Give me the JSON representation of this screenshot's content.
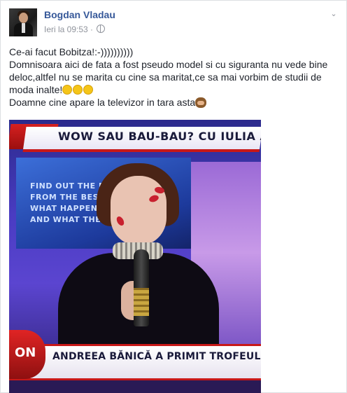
{
  "post": {
    "author": "Bogdan Vladau",
    "timestamp": "Ieri la 09:53",
    "separator": " · ",
    "privacy_icon": "globe-icon",
    "menu_icon": "chevron-down-icon",
    "lines": [
      "Ce-ai facut Bobitza!:-))))))))))",
      "Domnisoara aici de fata a fost pseudo model si cu siguranta nu vede bine deloc,altfel nu se marita cu cine sa maritat,ce sa mai vorbim de studii de moda inalte!",
      "Doamne cine apare la televizor in tara asta"
    ],
    "emoji_after_line_2": [
      "grinning-squint-face",
      "grimacing-face",
      "grinning-squint-face"
    ],
    "emoji_after_line_3": "see-no-evil-monkey"
  },
  "photo": {
    "banner_text": "WOW SAU BAU-BAU? CU IULIA ALB",
    "screen_lines": [
      "FIND OUT THE BE       COVE",
      "FROM THE BEST         E SCE",
      "WHAT HAPPENS         R",
      "AND WHAT THE"
    ],
    "lower_logo": "ON",
    "lower_third_text": "ANDREEA BĂNICĂ A PRIMIT TROFEUL BAU-BAU"
  }
}
